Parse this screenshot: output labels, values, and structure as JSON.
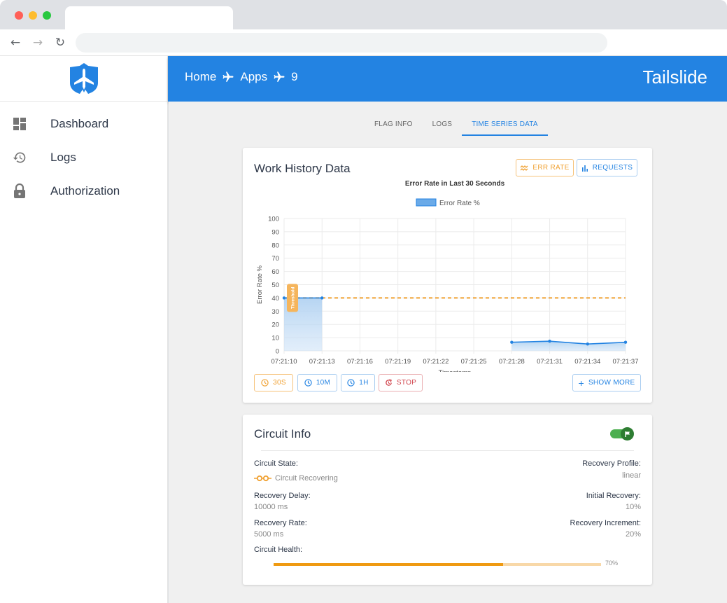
{
  "browser": {
    "back_icon": "arrow-left-icon",
    "forward_icon": "arrow-right-icon",
    "reload_icon": "reload-icon"
  },
  "sidebar": {
    "logo": "shield-plane-logo",
    "items": [
      {
        "label": "Dashboard",
        "icon": "dashboard-icon"
      },
      {
        "label": "Logs",
        "icon": "history-icon"
      },
      {
        "label": "Authorization",
        "icon": "lock-icon"
      }
    ]
  },
  "header": {
    "breadcrumbs": [
      "Home",
      "Apps",
      "9"
    ],
    "separator_icon": "airplane-icon",
    "brand": "Tailslide",
    "color": "#2383e2"
  },
  "tabs": [
    {
      "label": "FLAG INFO",
      "active": false
    },
    {
      "label": "LOGS",
      "active": false
    },
    {
      "label": "TIME SERIES DATA",
      "active": true
    }
  ],
  "work_history": {
    "title": "Work History Data",
    "buttons": {
      "err_rate": "ERR RATE",
      "requests": "REQUESTS"
    },
    "time_buttons": [
      {
        "label": "30S",
        "style": "orange",
        "icon": "clock-icon"
      },
      {
        "label": "10M",
        "style": "blue",
        "icon": "clock-icon"
      },
      {
        "label": "1H",
        "style": "blue",
        "icon": "clock-icon"
      },
      {
        "label": "STOP",
        "style": "red",
        "icon": "stop-refresh-icon"
      }
    ],
    "show_more": "SHOW MORE"
  },
  "chart_data": {
    "type": "line",
    "title": "Error Rate in Last 30 Seconds",
    "xlabel": "Timestamp",
    "ylabel": "Error Rate %",
    "categories": [
      "07:21:10",
      "07:21:13",
      "07:21:16",
      "07:21:19",
      "07:21:22",
      "07:21:25",
      "07:21:28",
      "07:21:31",
      "07:21:34",
      "07:21:37"
    ],
    "series": [
      {
        "name": "Error Rate %",
        "color": "#2383e2",
        "fill": true,
        "values": [
          40,
          40,
          null,
          null,
          null,
          null,
          6.5,
          7.3,
          5.2,
          6.5
        ]
      }
    ],
    "threshold": {
      "label": "Threshold",
      "value": 40,
      "color": "#f0a030",
      "style": "dashed"
    },
    "ylim": [
      0,
      100
    ],
    "yticks": [
      0,
      10,
      20,
      30,
      40,
      50,
      60,
      70,
      80,
      90,
      100
    ],
    "grid": true,
    "legend": "top-center"
  },
  "circuit_info": {
    "title": "Circuit Info",
    "toggle_on": true,
    "toggle_icon": "flag-icon",
    "state_label": "Circuit State:",
    "state_value": "Circuit Recovering",
    "state_icon": "recovering-icon",
    "recovery_profile_label": "Recovery Profile:",
    "recovery_profile_value": "linear",
    "recovery_delay_label": "Recovery Delay:",
    "recovery_delay_value": "10000 ms",
    "initial_recovery_label": "Initial Recovery:",
    "initial_recovery_value": "10%",
    "recovery_rate_label": "Recovery Rate:",
    "recovery_rate_value": "5000 ms",
    "recovery_increment_label": "Recovery Increment:",
    "recovery_increment_value": "20%",
    "health_label": "Circuit Health:",
    "health_percent": 70,
    "health_text": "70%"
  }
}
